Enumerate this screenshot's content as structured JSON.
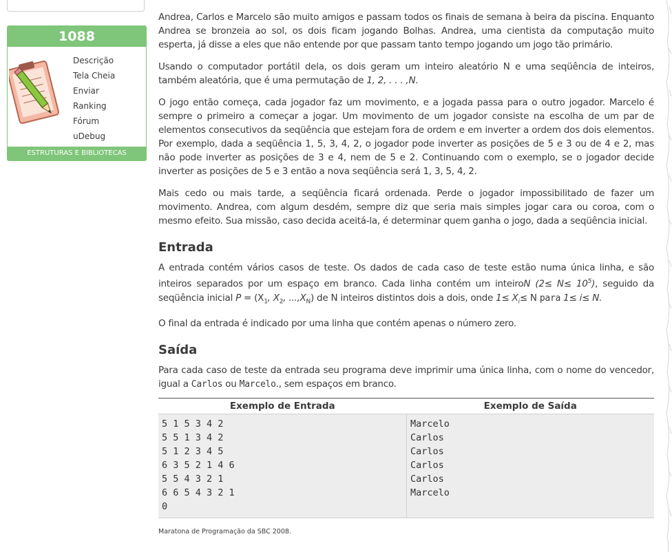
{
  "sidebar": {
    "problem_number": "1088",
    "menu": [
      "Descrição",
      "Tela Cheia",
      "Enviar",
      "Ranking",
      "Fórum",
      "uDebug"
    ],
    "category": "ESTRUTURAS E BIBLIOTECAS"
  },
  "statement": {
    "p1": "Andrea, Carlos e Marcelo são muito amigos e passam todos os finais de semana à beira da piscina. Enquanto Andrea se bronzeia ao sol, os dois ficam jogando Bolhas. Andrea, uma cientista da computação muito esperta, já disse a eles que não entende por que passam tanto tempo jogando um jogo tão primário.",
    "p2_a": "Usando o computador portátil dela, os dois geram um inteiro aleatório N e uma seqüência de inteiros, também aleatória, que é uma permutação de ",
    "p2_b": "1, 2, . . . ,N",
    "p2_c": ".",
    "p3": "O jogo então começa, cada jogador faz um movimento, e a jogada passa para o outro jogador. Marcelo é sempre o primeiro a começar a jogar. Um movimento de um jogador consiste na escolha de um par de elementos consecutivos da seqüência que estejam fora de ordem e em inverter a ordem dos dois elementos. Por exemplo, dada a seqüência 1, 5, 3, 4, 2, o jogador pode inverter as posições de 5 e 3 ou de 4 e 2, mas não pode inverter as posições de 3 e 4, nem de 5 e 2. Continuando com o exemplo, se o jogador decide inverter as posições de 5 e 3 então a nova seqüência será 1, 3, 5, 4, 2.",
    "p4": "Mais cedo ou mais tarde, a seqüência ficará ordenada. Perde o jogador impossibilitado de fazer um movimento. Andrea, com algum desdém, sempre diz que seria mais simples jogar cara ou coroa, com o mesmo efeito. Sua missão, caso decida aceitá-la, é determinar quem ganha o jogo, dada a seqüência inicial."
  },
  "input": {
    "heading": "Entrada",
    "p1_a": "A entrada contém vários casos de teste. Os dados de cada caso de teste estão numa única linha, e são inteiros separados por um espaço em branco. Cada linha contém um inteiro",
    "p1_n": "N",
    "p1_range": "(2≤ N≤ 10",
    "p1_exp": "5",
    "p1_range_end": ")",
    "p1_b": ", seguido da seqüência inicial ",
    "p1_p": "P",
    "p1_eq": " = (X",
    "p1_s1": "1",
    "p1_x2": ", X",
    "p1_s2": "2",
    "p1_dots": ", ...,X",
    "p1_sn": "N",
    "p1_close": ")",
    "p1_c": " de N inteiros distintos dois a dois, onde ",
    "p1_cond1": "1≤ X",
    "p1_si": "i",
    "p1_cond2": "≤ N",
    "p1_para": "para",
    "p1_cond3": "1≤ i≤ N.",
    "p2": "O final da entrada é indicado por uma linha que contém apenas o número zero."
  },
  "output": {
    "heading": "Saída",
    "p1_a": "Para cada caso de teste da entrada seu programa deve imprimir uma única linha, com o nome do vencedor, igual a ",
    "carlos": "Carlos",
    "ou": " ou ",
    "marcelo": "Marcelo",
    "p1_b": "., sem espaços em branco."
  },
  "samples": {
    "input_header": "Exemplo de Entrada",
    "output_header": "Exemplo de Saída",
    "input_lines": [
      "5 1 5 3 4 2",
      "5 5 1 3 4 2",
      "5 1 2 3 4 5",
      "6 3 5 2 1 4 6",
      "5 5 4 3 2 1",
      "6 6 5 4 3 2 1",
      "0"
    ],
    "output_lines": [
      "Marcelo",
      "Carlos",
      "Carlos",
      "Carlos",
      "Carlos",
      "Marcelo"
    ]
  },
  "source": "Maratona de Programação da SBC 2008.",
  "colors": {
    "accent": "#7fc57a",
    "text": "#3b3b3b",
    "sample_bg": "#ededed"
  }
}
